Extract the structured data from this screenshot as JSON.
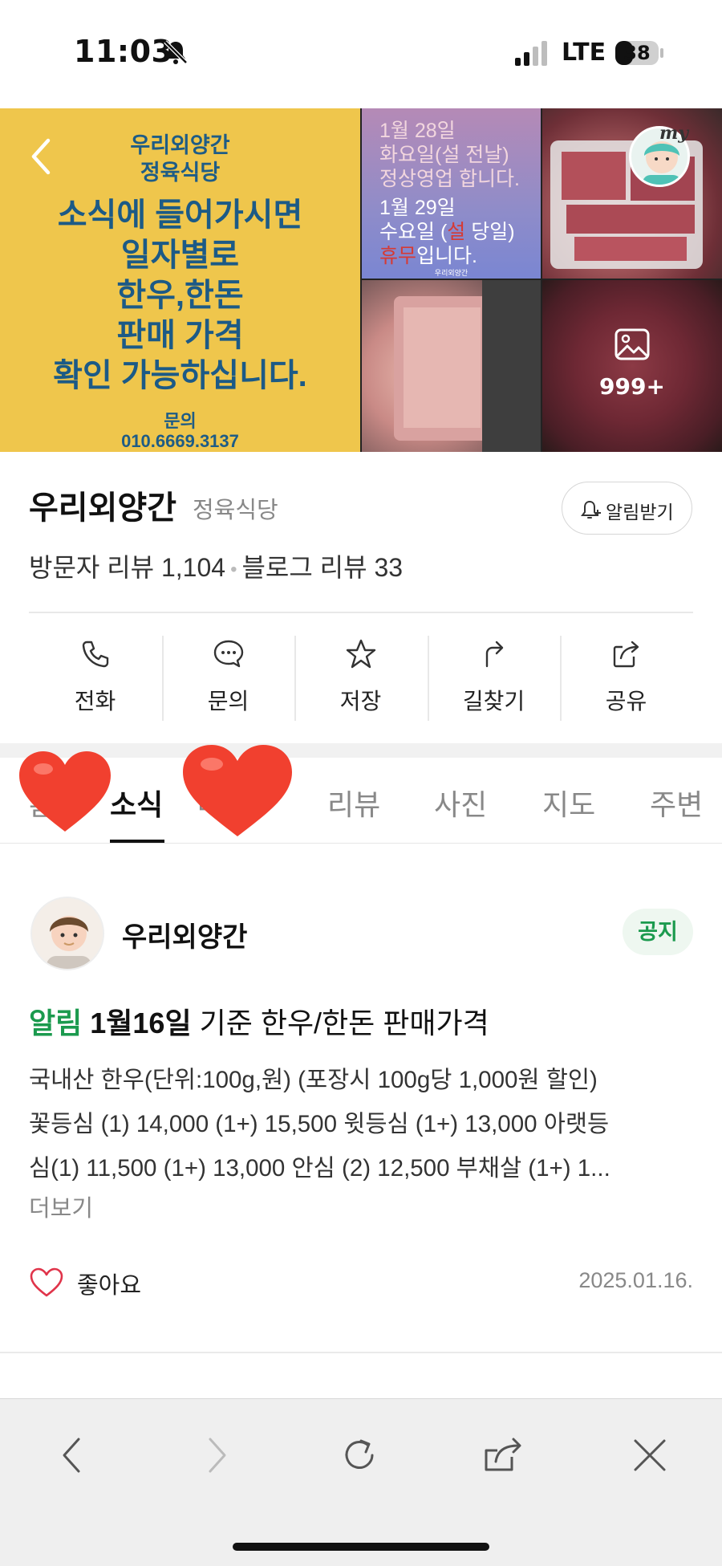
{
  "status_bar": {
    "time": "11:03",
    "network": "LTE",
    "battery": "38"
  },
  "gallery": {
    "main_poster": {
      "title_line1": "우리외양간",
      "title_line2": "정육식당",
      "lines": [
        "소식에 들어가시면",
        "일자별로",
        "한우,한돈",
        "판매 가격",
        "확인 가능하십니다."
      ],
      "contact_label": "문의",
      "contact_phone": "010.6669.3137"
    },
    "notice_image": {
      "lines": [
        "1월 28일",
        "화요일(설 전날)",
        "정상영업 합니다."
      ],
      "bright_line1": "1월 29일",
      "bright_line2_a": "수요일 (",
      "bright_line2_red": "설",
      "bright_line2_b": " 당일)",
      "bright_line3_red": "휴무",
      "bright_line3_b": "입니다.",
      "footer": "우리외양간"
    },
    "my_badge": "my",
    "more_count": "999+"
  },
  "place": {
    "name": "우리외양간",
    "category": "정육식당",
    "alert_button": "알림받기",
    "visitor_review_label": "방문자 리뷰",
    "visitor_review_count": "1,104",
    "blog_review_label": "블로그 리뷰",
    "blog_review_count": "33"
  },
  "actions": [
    {
      "label": "전화",
      "icon": "phone-icon"
    },
    {
      "label": "문의",
      "icon": "chat-icon"
    },
    {
      "label": "저장",
      "icon": "star-icon"
    },
    {
      "label": "길찾기",
      "icon": "directions-icon"
    },
    {
      "label": "공유",
      "icon": "share-icon"
    }
  ],
  "tabs": [
    {
      "label": "홈"
    },
    {
      "label": "소식",
      "active": true
    },
    {
      "label": "메뉴"
    },
    {
      "label": "리뷰"
    },
    {
      "label": "사진"
    },
    {
      "label": "지도"
    },
    {
      "label": "주변"
    }
  ],
  "post": {
    "author": "우리외양간",
    "badge": "공지",
    "title_tag": "알림",
    "title_date": "1월16일",
    "title_rest": " 기준 한우/한돈 판매가격",
    "body_lines": [
      "국내산 한우(단위:100g,원) (포장시 100g당 1,000원 할인)",
      "꽃등심 (1) 14,000 (1+) 15,500 윗등심 (1+) 13,000 아랫등",
      "심(1) 11,500 (1+) 13,000 안심 (2) 12,500 부채살 (1+) 1..."
    ],
    "more_link": "더보기",
    "like_label": "좋아요",
    "date": "2025.01.16."
  },
  "colors": {
    "accent_green": "#1b9a4e",
    "poster_yellow": "#efc64c",
    "poster_blue": "#1c5a86",
    "heart_red": "#f1402f"
  }
}
